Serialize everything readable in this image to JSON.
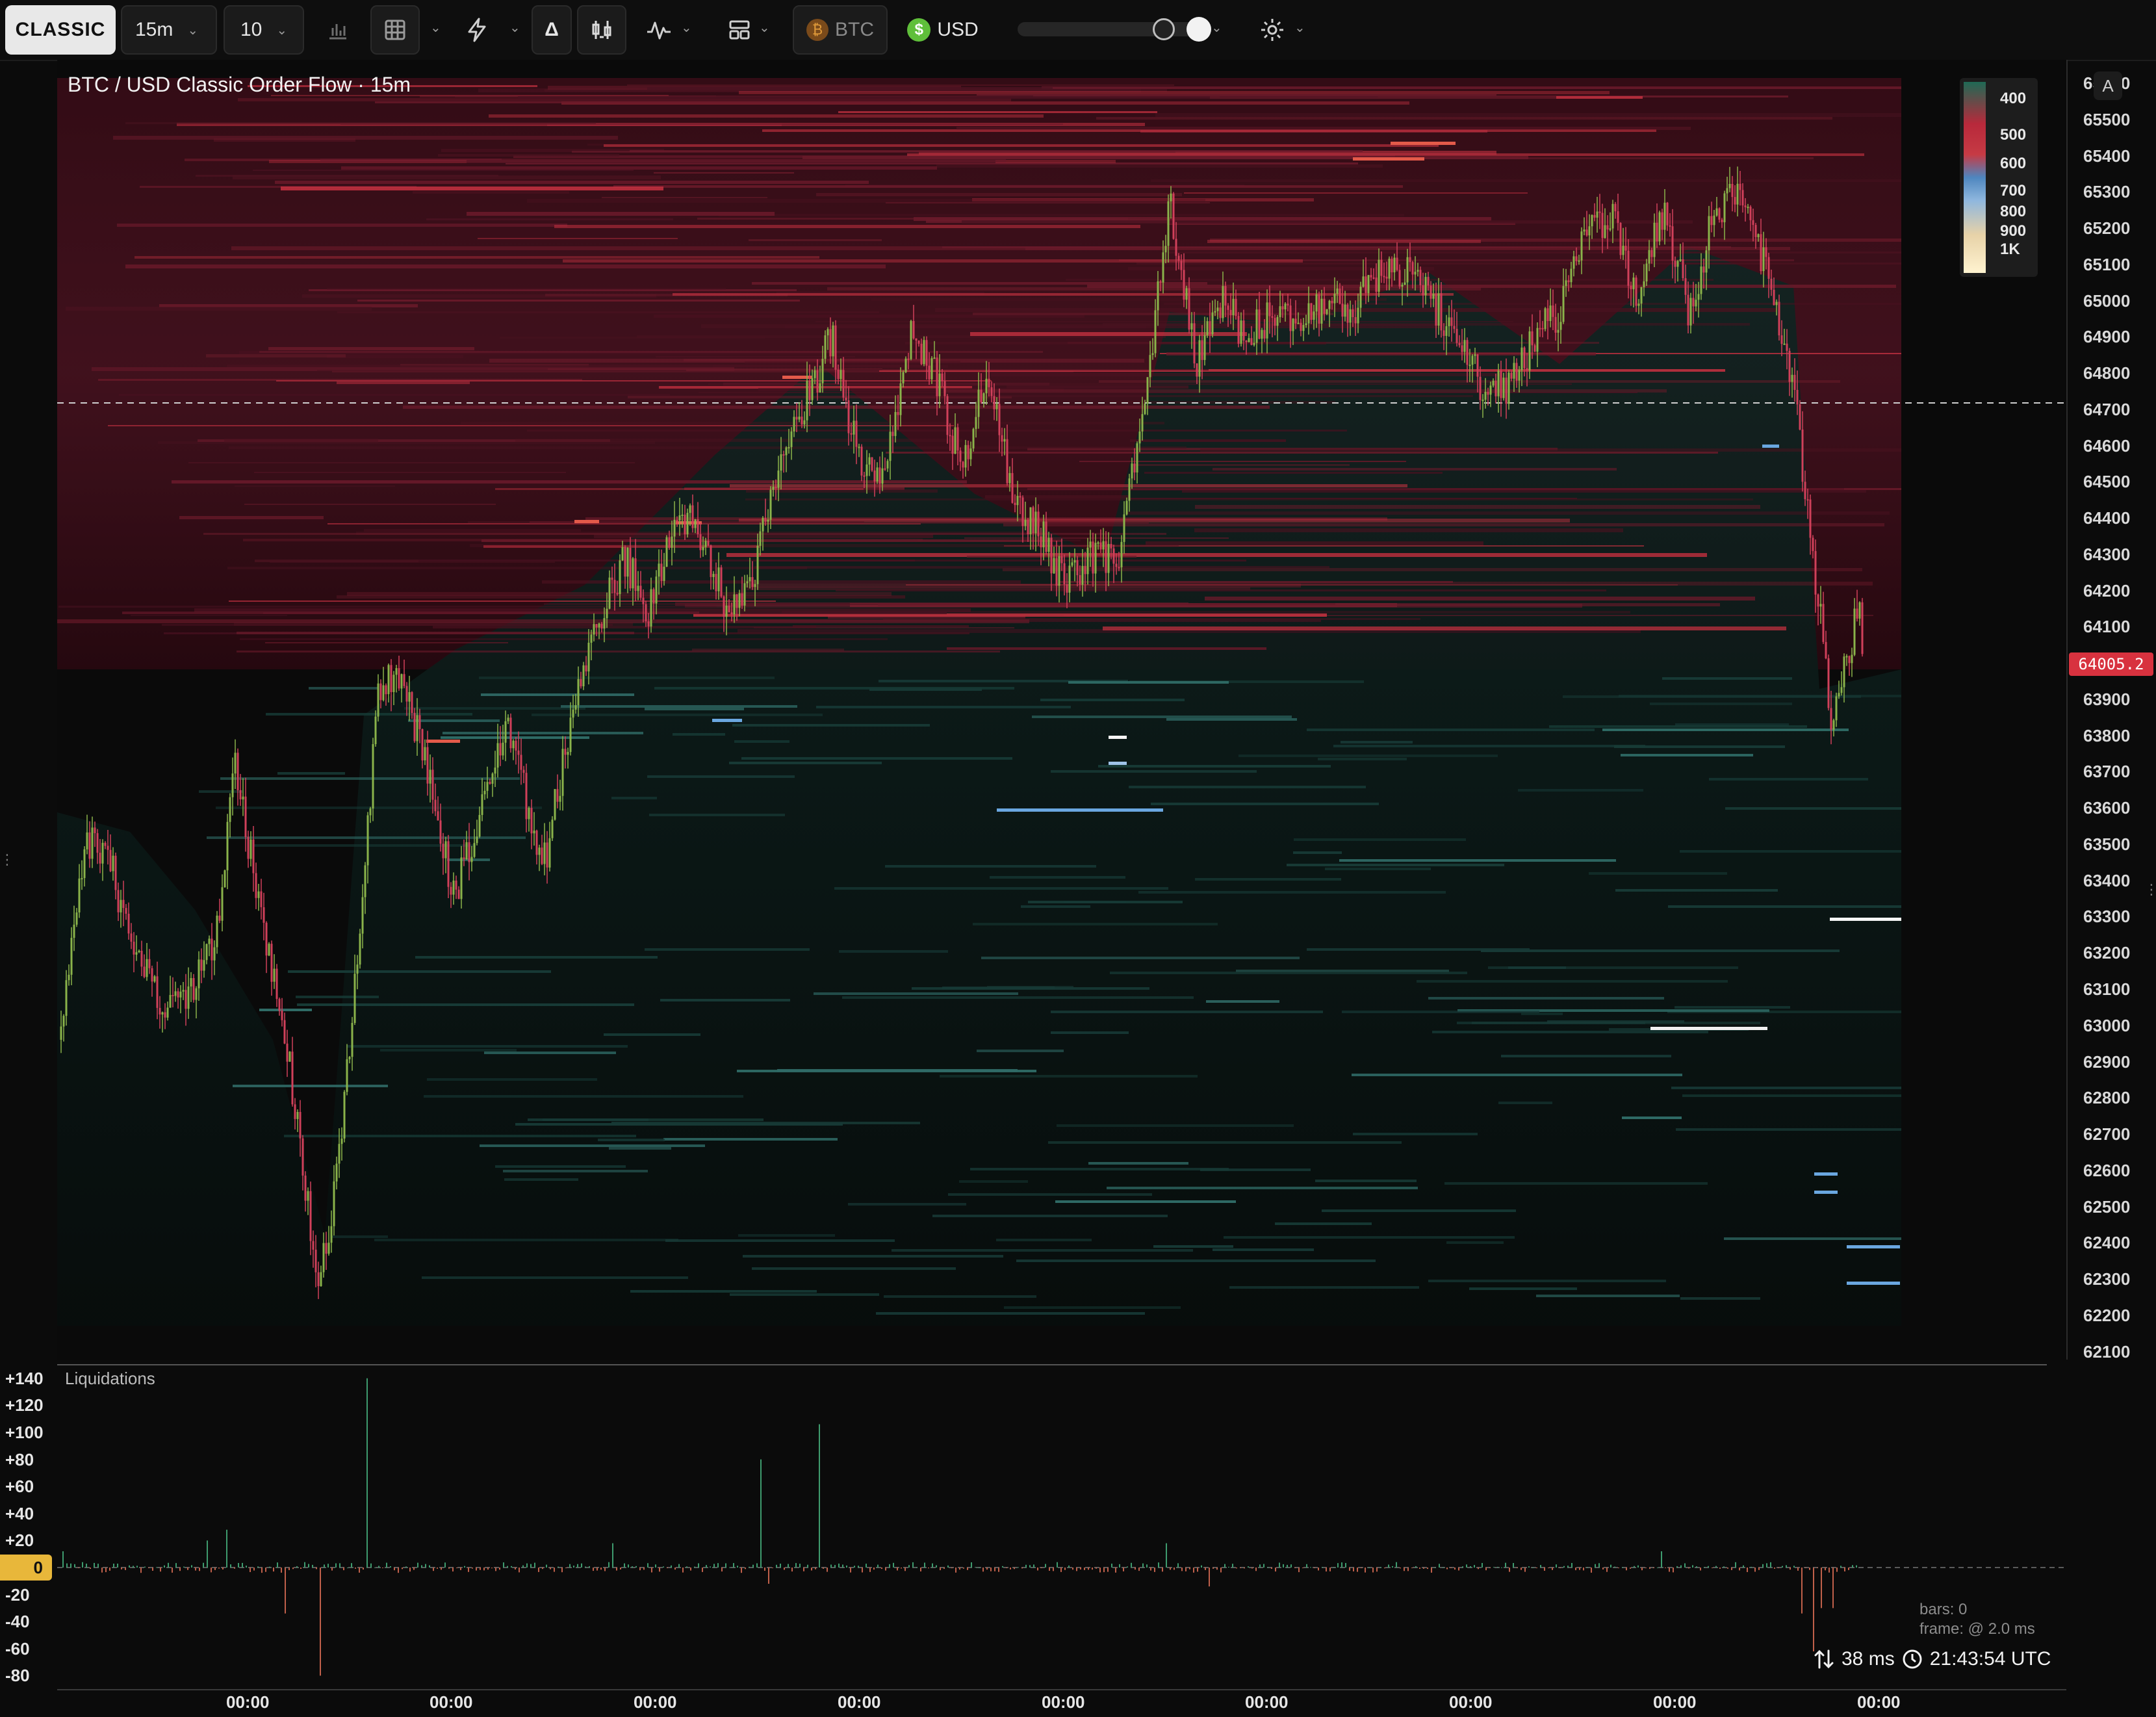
{
  "toolbar": {
    "mode_label": "CLASSIC",
    "timeframe": "15m",
    "depth": "10",
    "base_currency": "BTC",
    "quote_currency": "USD",
    "delta_label": "Δ"
  },
  "chart": {
    "title": "BTC / USD Classic Order Flow · 15m",
    "current_price": "64005.2",
    "price_ticks": [
      "65600",
      "65500",
      "65400",
      "65300",
      "65200",
      "65100",
      "65000",
      "64900",
      "64800",
      "64700",
      "64600",
      "64500",
      "64400",
      "64300",
      "64200",
      "64100",
      "63900",
      "63800",
      "63700",
      "63600",
      "63500",
      "63400",
      "63300",
      "63200",
      "63100",
      "63000",
      "62900",
      "62800",
      "62700",
      "62600",
      "62500",
      "62400",
      "62300",
      "62200",
      "62100"
    ],
    "legend_ticks": [
      "400",
      "500",
      "600",
      "700",
      "800",
      "900",
      "1K"
    ],
    "time_ticks": [
      "00:00",
      "00:00",
      "00:00",
      "00:00",
      "00:00",
      "00:00",
      "00:00",
      "00:00",
      "00:00"
    ]
  },
  "liquidations": {
    "label": "Liquidations",
    "ticks": [
      "+140",
      "+120",
      "+100",
      "+80",
      "+60",
      "+40",
      "+20",
      "0",
      "-20",
      "-40",
      "-60",
      "-80"
    ],
    "zero_label": "0"
  },
  "stats": {
    "bars": "bars: 0",
    "frame": "frame: @ 2.0 ms"
  },
  "status": {
    "latency": "38 ms",
    "clock": "21:43:54 UTC"
  },
  "colors": {
    "ask_heat": "#7a1b2a",
    "bid_heat": "#0f2a26",
    "candle_up": "#8ab34a",
    "candle_down": "#d0405a",
    "price_badge": "#d8323f",
    "zero_badge": "#e8b73a"
  }
}
